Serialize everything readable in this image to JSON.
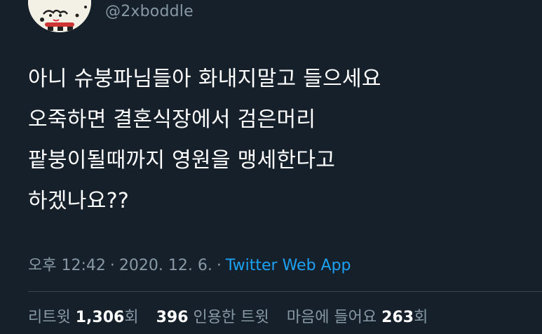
{
  "author": {
    "handle": "@2xboddle",
    "avatar_icon": "cartoon-character-avatar"
  },
  "tweet": {
    "lines": [
      "아니 슈붕파님들아 화내지말고 들으세요",
      "오죽하면 결혼식장에서 검은머리",
      "팥붕이될때까지 영원을 맹세한다고",
      "하겠나요??"
    ]
  },
  "meta": {
    "ampm": "오후",
    "time": "12:42",
    "date": "2020. 12. 6.",
    "source": "Twitter Web App",
    "separator": "·"
  },
  "stats": {
    "retweets_label": "리트윗",
    "retweets_count": "1,306",
    "retweets_suffix": "회",
    "quotes_count": "396",
    "quotes_label": "인용한 트윗",
    "likes_label": "마음에 들어요",
    "likes_count": "263",
    "likes_suffix": "회"
  },
  "colors": {
    "background": "#15202b",
    "secondary_text": "#8899a6",
    "link": "#1da1f2",
    "divider": "#38444d"
  }
}
